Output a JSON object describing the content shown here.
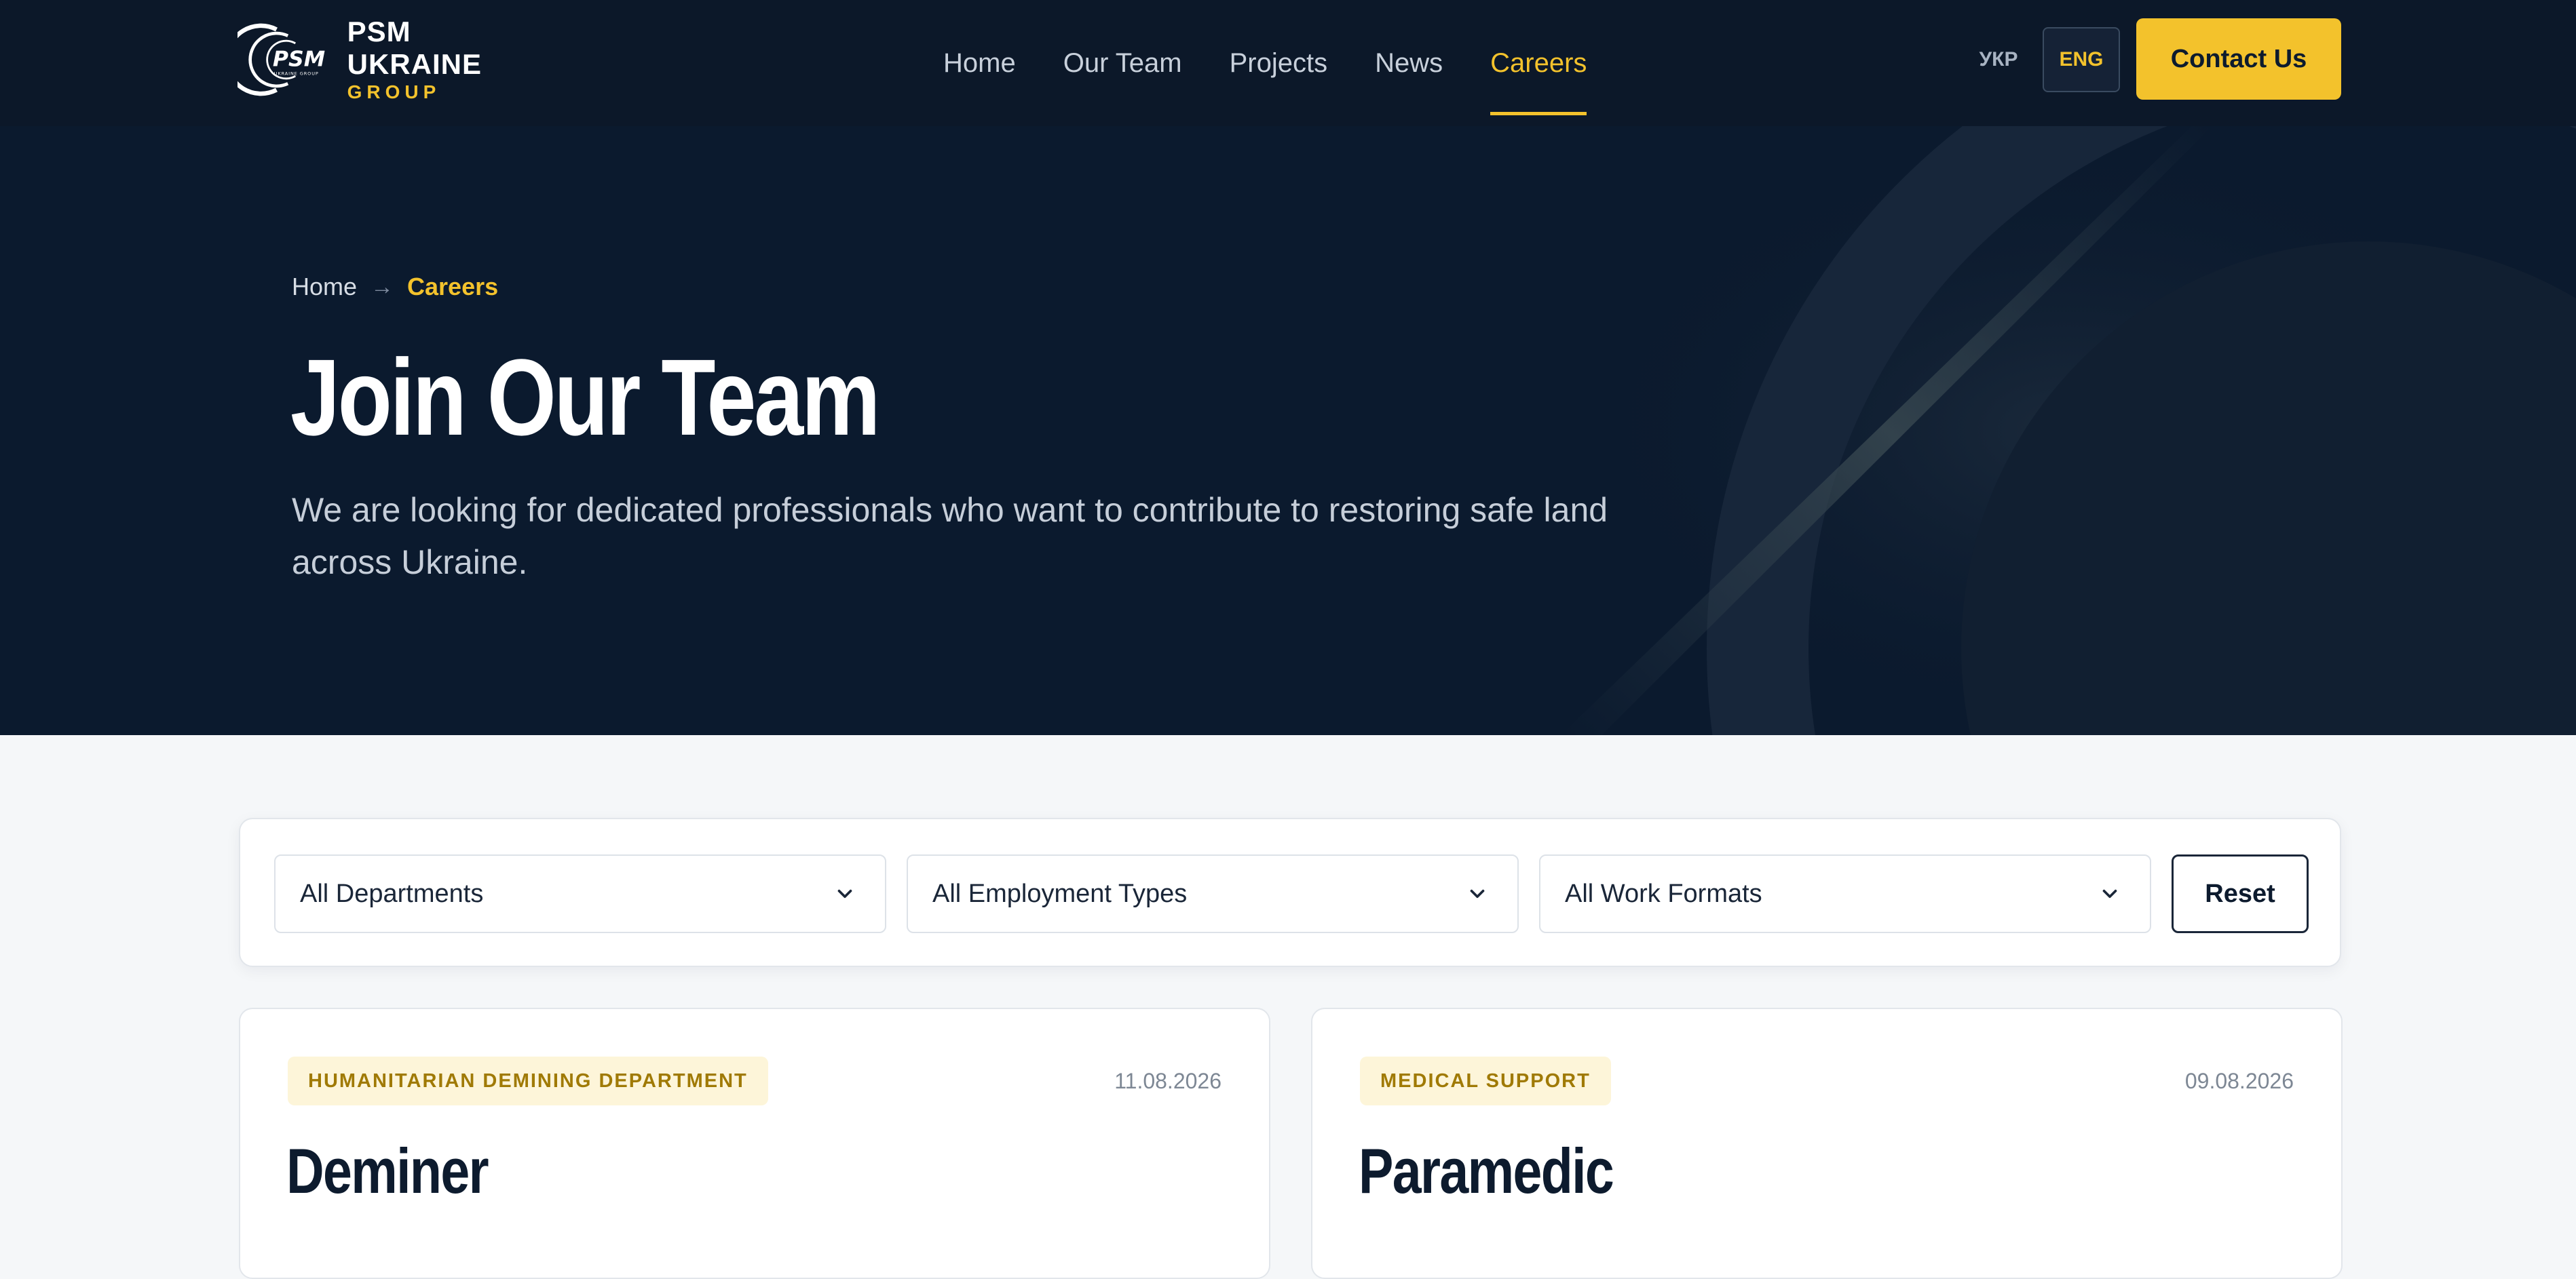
{
  "brand": {
    "mark_text": "PSM",
    "mark_subtext": "UKRAINE GROUP",
    "line1": "PSM",
    "line2": "UKRAINE",
    "line3": "GROUP"
  },
  "nav": {
    "items": [
      {
        "label": "Home"
      },
      {
        "label": "Our Team"
      },
      {
        "label": "Projects"
      },
      {
        "label": "News"
      },
      {
        "label": "Careers"
      }
    ],
    "active": "Careers"
  },
  "language": {
    "ukr": "УКР",
    "eng": "ENG",
    "selected": "ENG"
  },
  "header": {
    "contact_label": "Contact Us"
  },
  "hero": {
    "breadcrumb": {
      "home": "Home",
      "separator": "→",
      "current": "Careers"
    },
    "title": "Join Our Team",
    "subtitle": "We are looking for dedicated professionals who want to contribute to restoring safe land across Ukraine."
  },
  "filters": {
    "department": "All Departments",
    "employment_type": "All Employment Types",
    "work_format": "All Work Formats",
    "reset_label": "Reset"
  },
  "jobs": [
    {
      "department": "HUMANITARIAN DEMINING DEPARTMENT",
      "date": "11.08.2026",
      "title": "Deminer"
    },
    {
      "department": "MEDICAL SUPPORT",
      "date": "09.08.2026",
      "title": "Paramedic"
    }
  ],
  "colors": {
    "header_bg": "#0c1829",
    "hero_bg": "#0b1a2e",
    "accent": "#f3c22c",
    "page_bg": "#f5f7f9",
    "text_dark": "#0d1b2e"
  },
  "icons": {
    "select_chevron": "chevron-down-icon",
    "logo": "psm-logo-icon"
  }
}
